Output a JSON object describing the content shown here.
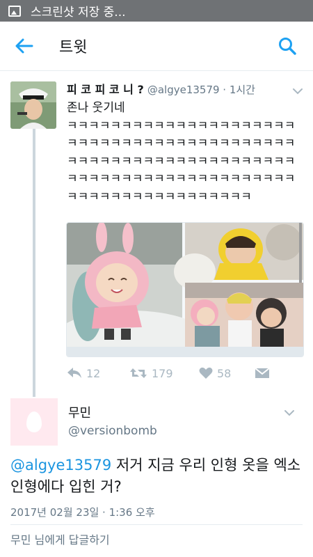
{
  "status_bar": {
    "text": "스크린샷 저장 중...",
    "icon": "gallery-icon"
  },
  "app_bar": {
    "title": "트윗",
    "back_icon": "arrow-left-icon",
    "search_icon": "search-icon",
    "accent": "#1da1f2"
  },
  "tweet1": {
    "author_name": "피 코 피 코 니 ?",
    "handle_time": "@algye13579 · 1시간",
    "text": "존나 웃기네\nㅋㅋㅋㅋㅋㅋㅋㅋㅋㅋㅋㅋㅋㅋㅋㅋㅋㅋㅋㅋㅋㅋㅋㅋㅋㅋㅋㅋㅋㅋㅋㅋㅋㅋㅋㅋㅋㅋㅋㅋㅋㅋㅋㅋㅋㅋㅋㅋㅋㅋㅋㅋㅋㅋㅋㅋㅋㅋㅋㅋㅋㅋㅋㅋㅋㅋㅋㅋㅋㅋㅋㅋㅋㅋㅋㅋㅋㅋㅋㅋㅋㅋㅋㅋㅋㅋㅋㅋㅋㅋㅋㅋㅋㅋㅋㅋㅋㅋㅋㅋㅋ",
    "reply_count": "12",
    "retweet_count": "179",
    "like_count": "58"
  },
  "tweet2": {
    "author_name": "무민",
    "handle": "@versionbomb",
    "mention": "@algye13579",
    "text": " 저거 지금 우리 인형 옷을 엑소 인형에다 입힌 거?",
    "timestamp": "2017년 02월 23일 · 1:36 오후",
    "reply_prompt": "무민 님에게 답글하기"
  }
}
